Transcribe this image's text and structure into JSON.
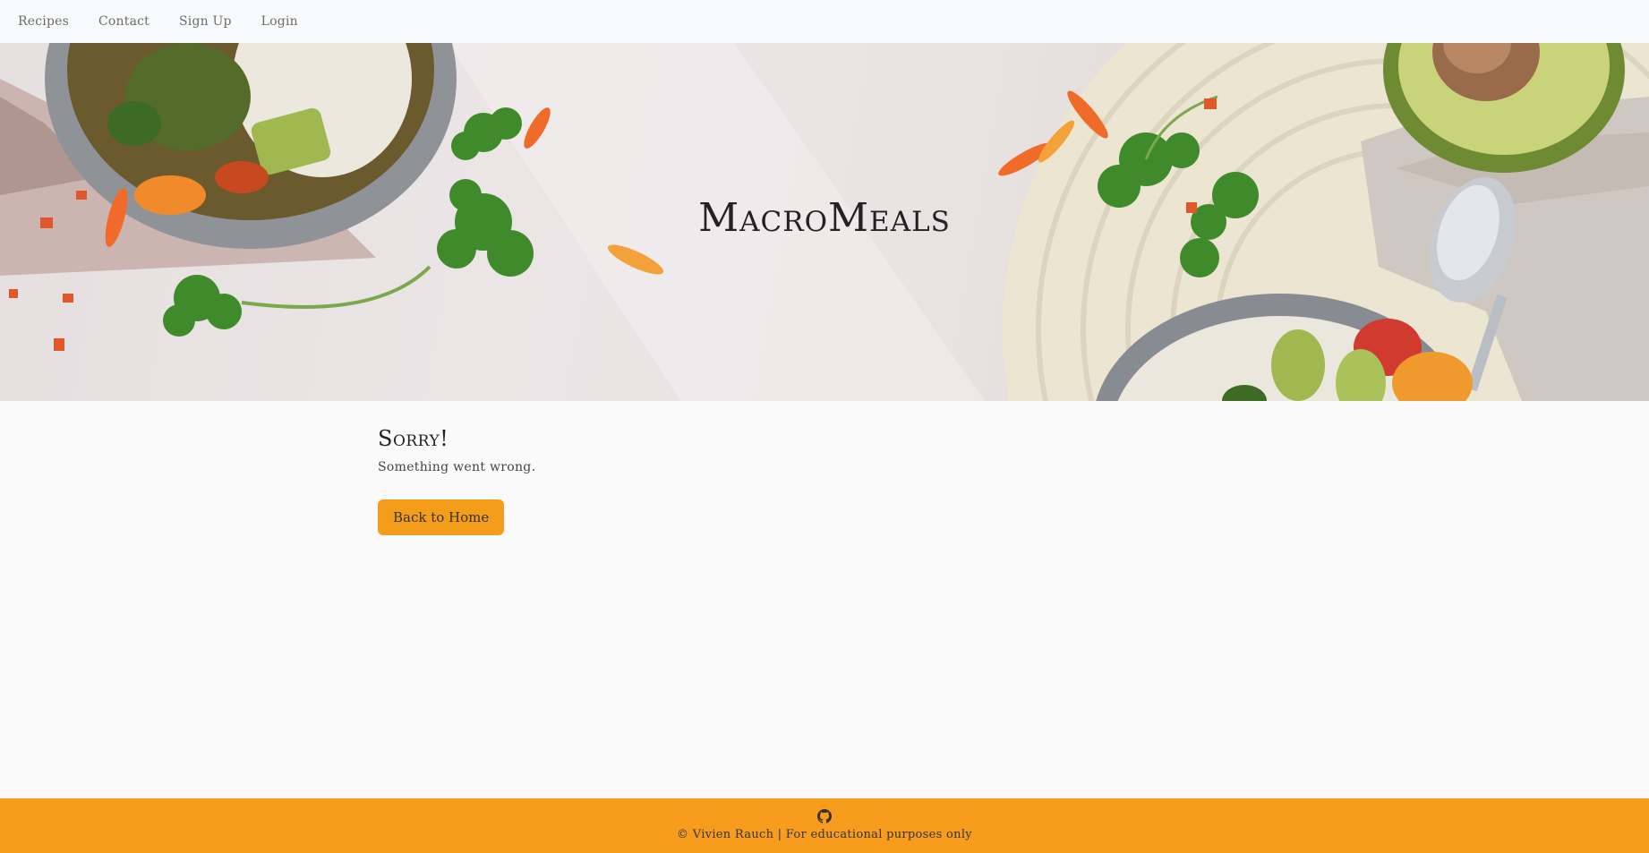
{
  "nav": {
    "items": [
      {
        "label": "Recipes"
      },
      {
        "label": "Contact"
      },
      {
        "label": "Sign Up"
      },
      {
        "label": "Login"
      }
    ]
  },
  "hero": {
    "title": "MacroMeals",
    "image_icon": "food-bowl-image"
  },
  "main": {
    "title": "Sorry!",
    "message": "Something went wrong.",
    "button_label": "Back to Home"
  },
  "footer": {
    "icon": "github-icon",
    "text": "© Vivien Rauch | For educational purposes only"
  },
  "colors": {
    "accent": "#f49d1a",
    "footer_bg": "#f79c1c",
    "navbar_bg": "#f8f9fa",
    "page_bg": "#fafafa"
  }
}
